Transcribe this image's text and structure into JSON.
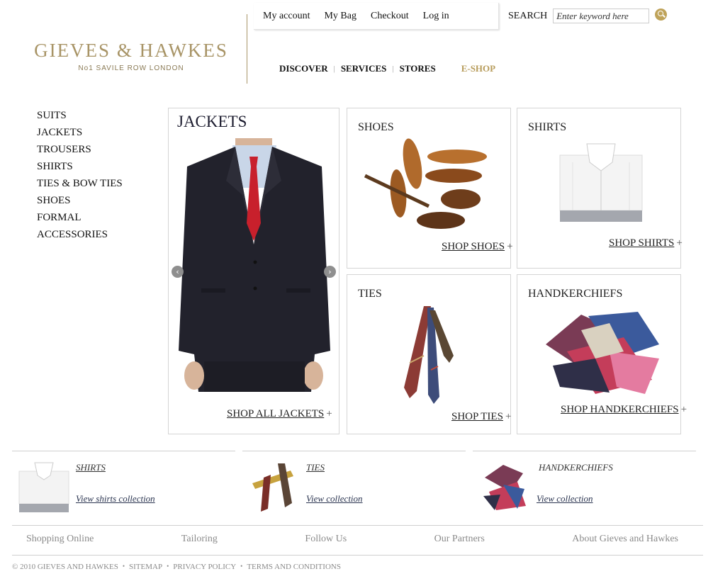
{
  "brand": {
    "name": "GIEVES & HAWKES",
    "tagline": "No1 SAVILE ROW LONDON",
    "gold": "#a89466"
  },
  "account_nav": {
    "my_account": "My account",
    "my_bag": "My Bag",
    "checkout": "Checkout",
    "log_in": "Log in"
  },
  "search": {
    "label": "SEARCH",
    "placeholder": "Enter keyword here",
    "button_icon": "search-icon"
  },
  "main_nav": {
    "discover": "DISCOVER",
    "services": "SERVICES",
    "stores": "STORES",
    "eshop": "E-SHOP",
    "separator": "|"
  },
  "categories": [
    "SUITS",
    "JACKETS",
    "TROUSERS",
    "SHIRTS",
    "TIES & BOW TIES",
    "SHOES",
    "FORMAL",
    "ACCESSORIES"
  ],
  "panels": {
    "jackets": {
      "title": "JACKETS",
      "link": "SHOP ALL JACKETS",
      "plus": "+",
      "prev_icon": "chevron-left-icon",
      "next_icon": "chevron-right-icon",
      "prev": "‹",
      "next": "›"
    },
    "shoes": {
      "title": "SHOES",
      "link": "SHOP SHOES",
      "plus": "+"
    },
    "shirts": {
      "title": "SHIRTS",
      "link": "SHOP SHIRTS",
      "plus": "+"
    },
    "ties": {
      "title": "TIES",
      "link": "SHOP TIES",
      "plus": "+"
    },
    "handkerchiefs": {
      "title": "HANDKERCHIEFS",
      "link": "SHOP HANDKERCHIEFS",
      "plus": "+"
    }
  },
  "promos": [
    {
      "title": "SHIRTS",
      "link": "View shirts collection"
    },
    {
      "title": "TIES",
      "link": "View collection"
    },
    {
      "title": "HANDKERCHIEFS",
      "link": "View collection"
    }
  ],
  "footer": {
    "links": [
      "Shopping Online",
      "Tailoring",
      "Follow Us",
      "Our Partners",
      "About Gieves and Hawkes"
    ],
    "copyright": "© 2010 GIEVES AND HAWKES",
    "sitemap": "SITEMAP",
    "privacy": "PRIVACY POLICY",
    "terms": "TERMS AND CONDITIONS",
    "dot": "•"
  }
}
